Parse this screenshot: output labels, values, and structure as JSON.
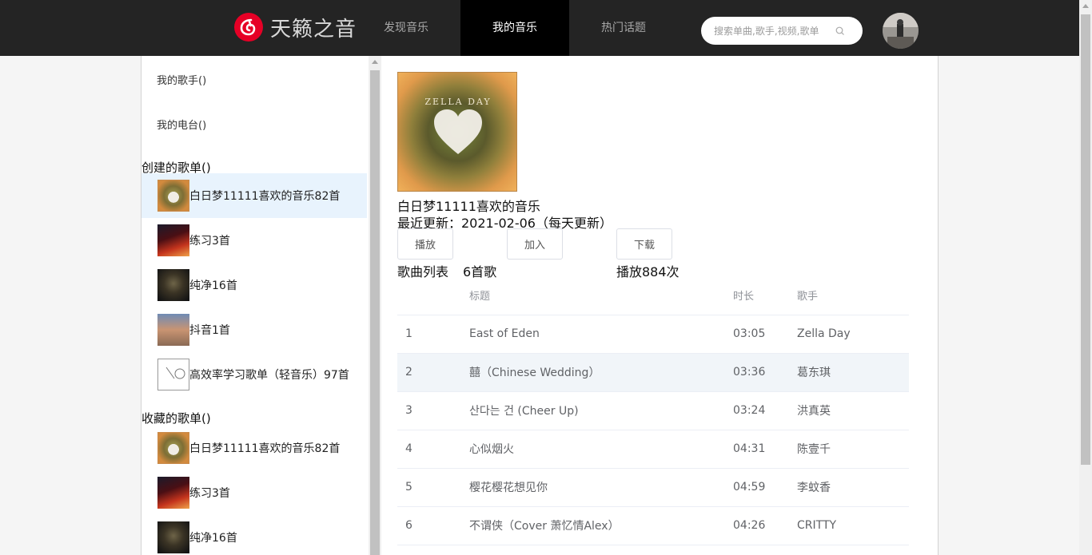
{
  "header": {
    "logo_text": "天籁之音",
    "nav": [
      {
        "label": "发现音乐"
      },
      {
        "label": "我的音乐",
        "active": true
      },
      {
        "label": "热门话题"
      }
    ],
    "search_placeholder": "搜索单曲,歌手,视频,歌单"
  },
  "sidebar": {
    "links": [
      {
        "label": "我的歌手()"
      },
      {
        "label": "我的电台()"
      }
    ],
    "created_heading": "创建的歌单()",
    "created": [
      {
        "label": "白日梦11111喜欢的音乐82首",
        "cover": "cover-zella"
      },
      {
        "label": "练习3首",
        "cover": "cover-red"
      },
      {
        "label": "纯净16首",
        "cover": "cover-dark"
      },
      {
        "label": "抖音1首",
        "cover": "cover-man"
      },
      {
        "label": "高效率学习歌单（轻音乐）97首",
        "cover": "cover-drawing"
      }
    ],
    "collected_heading": "收藏的歌单()",
    "collected": [
      {
        "label": "白日梦11111喜欢的音乐82首",
        "cover": "cover-zella"
      },
      {
        "label": "练习3首",
        "cover": "cover-red"
      },
      {
        "label": "纯净16首",
        "cover": "cover-dark"
      }
    ]
  },
  "playlist": {
    "cover_text": "ZELLA DAY",
    "name": "白日梦11111喜欢的音乐",
    "updated": "最近更新：2021-02-06（每天更新）",
    "buttons": {
      "play": "播放",
      "add": "加入",
      "download": "下载"
    },
    "list_label": "歌曲列表",
    "song_count": "6首歌",
    "play_count": "播放884次",
    "columns": {
      "index": "",
      "title": "标题",
      "duration": "时长",
      "artist": "歌手"
    },
    "songs": [
      {
        "index": "1",
        "title": "East of Eden",
        "duration": "03:05",
        "artist": "Zella Day"
      },
      {
        "index": "2",
        "title": "囍（Chinese Wedding）",
        "duration": "03:36",
        "artist": "葛东琪"
      },
      {
        "index": "3",
        "title": "산다는 건 (Cheer Up)",
        "duration": "03:24",
        "artist": "洪真英"
      },
      {
        "index": "4",
        "title": "心似烟火",
        "duration": "04:31",
        "artist": "陈壹千"
      },
      {
        "index": "5",
        "title": "樱花樱花想见你",
        "duration": "04:59",
        "artist": "李蚊香"
      },
      {
        "index": "6",
        "title": "不谓侠（Cover 萧忆情Alex）",
        "duration": "04:26",
        "artist": "CRITTY"
      }
    ]
  }
}
